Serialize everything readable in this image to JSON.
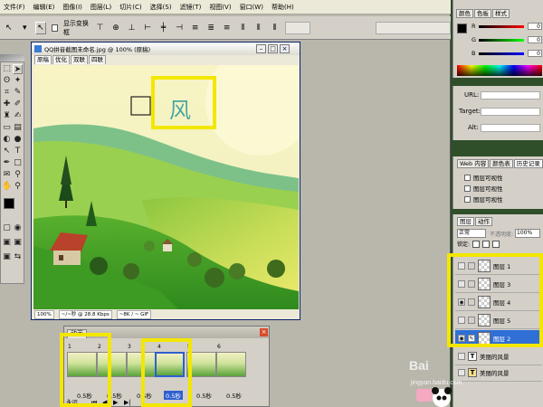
{
  "menu": [
    "文件(F)",
    "编辑(E)",
    "图像(I)",
    "图层(L)",
    "切片(C)",
    "选择(S)",
    "滤镜(T)",
    "视图(V)",
    "窗口(W)",
    "帮助(H)"
  ],
  "options": {
    "show_transform_label": "显示变换框"
  },
  "document": {
    "title": "QQ拼音截图未命名.jpg @ 100% (原稿)",
    "tabs": [
      "原稿",
      "优化",
      "双联",
      "四联"
    ],
    "overlay_char": "风",
    "status": [
      "100%",
      "~/~秒 @ 28.8 Kbps",
      "~8K / ~ GIF"
    ]
  },
  "animation": {
    "tab": "动画",
    "frames": [
      {
        "num": "1",
        "delay": "0.5秒"
      },
      {
        "num": "2",
        "delay": "0.5秒"
      },
      {
        "num": "3",
        "delay": "0.5秒"
      },
      {
        "num": "4",
        "delay": "0.5秒"
      },
      {
        "num": "5",
        "delay": "0.5秒"
      },
      {
        "num": "6",
        "delay": "0.5秒"
      }
    ],
    "selected_frame": 4,
    "loop": "永远"
  },
  "color_panel": {
    "tabs": [
      "颜色",
      "色板",
      "样式"
    ],
    "channels": [
      {
        "label": "R",
        "value": "0",
        "color": "#d02020"
      },
      {
        "label": "G",
        "value": "0",
        "color": "#20a020"
      },
      {
        "label": "B",
        "value": "0",
        "color": "#2040d0"
      }
    ]
  },
  "url_panel": {
    "labels": [
      "URL:",
      "Target:",
      "Alt:"
    ]
  },
  "history_panel": {
    "tabs": [
      "Web 内容",
      "颜色表",
      "历史记录"
    ],
    "items": [
      "图层可视性",
      "图层可视性",
      "图层可视性"
    ]
  },
  "layers_panel": {
    "tabs": [
      "图层",
      "动作"
    ],
    "blend_mode": "正常",
    "opacity_label": "不透明度:",
    "opacity": "100%",
    "lock_label": "锁定:",
    "layers": [
      {
        "name": "图层 1",
        "visible": false,
        "kind": "pixel"
      },
      {
        "name": "图层 3",
        "visible": false,
        "kind": "pixel"
      },
      {
        "name": "图层 4",
        "visible": true,
        "kind": "pixel"
      },
      {
        "name": "图层 5",
        "visible": false,
        "kind": "pixel"
      },
      {
        "name": "图层 2",
        "visible": true,
        "kind": "pixel",
        "selected": true
      },
      {
        "name": "美丽的风景",
        "visible": false,
        "kind": "text"
      },
      {
        "name": "美丽的风景",
        "visible": false,
        "kind": "text"
      }
    ]
  },
  "watermark": {
    "brand": "Bai",
    "url": "jingyan.baidu.com"
  },
  "highlight_color": "#f3e700"
}
